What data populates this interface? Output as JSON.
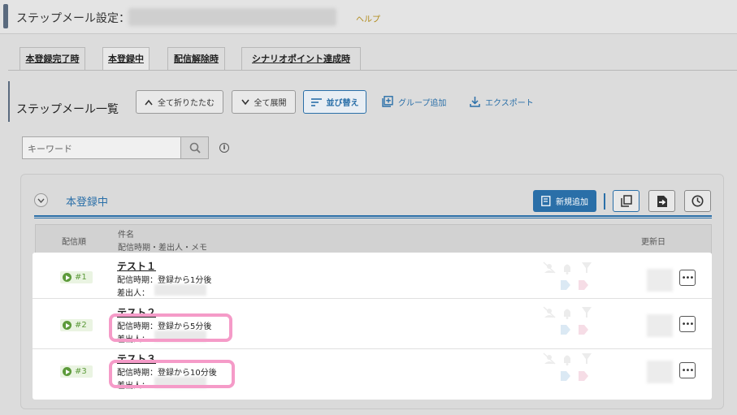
{
  "header": {
    "title": "ステップメール設定：",
    "help": "ヘルプ"
  },
  "tabs": [
    {
      "label": "本登録完了時"
    },
    {
      "label": "本登録中"
    },
    {
      "label": "配信解除時"
    },
    {
      "label": "シナリオポイント達成時"
    }
  ],
  "list": {
    "title": "ステップメール一覧",
    "collapse_all": "全て折りたたむ",
    "expand_all": "全て展開",
    "sort": "並び替え",
    "add_group": "グループ追加",
    "export": "エクスポート"
  },
  "search": {
    "placeholder": "キーワード"
  },
  "group": {
    "title": "本登録中",
    "add_new": "新規追加"
  },
  "table": {
    "col_order": "配信順",
    "col_subject": "件名",
    "col_subject_sub": "配信時期・差出人・メモ",
    "col_updated": "更新日"
  },
  "rows": [
    {
      "num": "#1",
      "subject": "テスト１",
      "timing": "配信時期：登録から1分後",
      "sender": "差出人："
    },
    {
      "num": "#2",
      "subject": "テスト２",
      "timing": "配信時期：登録から5分後",
      "sender": "差出人："
    },
    {
      "num": "#3",
      "subject": "テスト３",
      "timing": "配信時期：登録から10分後",
      "sender": "差出人："
    }
  ],
  "colors": {
    "accent": "#2a6fa8",
    "badge": "#5c9a3a",
    "highlight": "#f59bc8"
  }
}
